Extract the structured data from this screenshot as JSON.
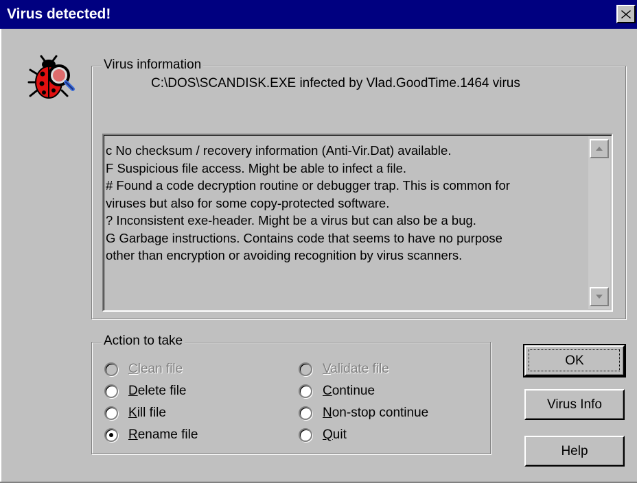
{
  "window": {
    "title": "Virus detected!"
  },
  "icons": {
    "app": "ladybug-magnifier-icon",
    "close": "close-icon"
  },
  "virus_info": {
    "legend": "Virus information",
    "infection": "C:\\DOS\\SCANDISK.EXE infected by Vlad.GoodTime.1464 virus",
    "details": [
      "c  No checksum / recovery information (Anti-Vir.Dat) available.",
      "F  Suspicious file access. Might be able to infect a file.",
      "#  Found a code decryption routine or debugger trap. This is common for",
      "viruses but also for some copy-protected software.",
      "?  Inconsistent exe-header. Might be a virus but can also be a bug.",
      "G  Garbage instructions. Contains code that seems to have no purpose",
      "other than encryption or avoiding recognition by virus scanners."
    ]
  },
  "action": {
    "legend": "Action to take",
    "options_left": [
      {
        "label": "Clean file",
        "enabled": false,
        "selected": false
      },
      {
        "label": "Delete file",
        "enabled": true,
        "selected": false
      },
      {
        "label": "Kill file",
        "enabled": true,
        "selected": false
      },
      {
        "label": "Rename file",
        "enabled": true,
        "selected": true
      }
    ],
    "options_right": [
      {
        "label": "Validate file",
        "enabled": false,
        "selected": false
      },
      {
        "label": "Continue",
        "enabled": true,
        "selected": false
      },
      {
        "label": "Non-stop continue",
        "enabled": true,
        "selected": false
      },
      {
        "label": "Quit",
        "enabled": true,
        "selected": false
      }
    ]
  },
  "buttons": {
    "ok": "OK",
    "virus_info": "Virus Info",
    "help": "Help"
  }
}
